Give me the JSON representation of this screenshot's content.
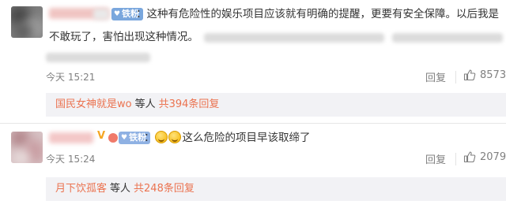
{
  "comments": [
    {
      "badge": "铁粉",
      "separator": "：",
      "text_line1": "这种有危险性的娱乐项目应该就有明确的提醒，更要有安全保障。以后我是",
      "text_line2": "不敢玩了，害怕出现这种情况。",
      "time": "今天 15:21",
      "reply_label": "回复",
      "like_count": "8573",
      "reply_user": "国民女神就是wo",
      "reply_mid": "等人",
      "reply_count": "共394条回复"
    },
    {
      "badge": "铁粉",
      "vmark": "V",
      "separator": "：",
      "text": "这么危险的项目早该取缔了",
      "time": "今天 15:24",
      "reply_label": "回复",
      "like_count": "2079",
      "reply_user": "月下饮孤客",
      "reply_mid": "等人",
      "reply_count": "共248条回复"
    }
  ],
  "colors": {
    "accent": "#eb7350",
    "badge": "#7aa7dd",
    "muted": "#808080"
  },
  "icons": [
    "thumbs-up-icon",
    "emoji-grin-icon",
    "heart-icon"
  ]
}
